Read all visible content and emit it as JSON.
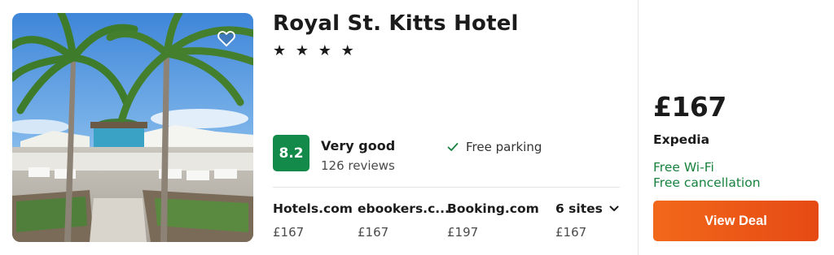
{
  "hotel": {
    "name": "Royal St. Kitts Hotel",
    "stars_text": "★ ★ ★ ★",
    "star_count": 4
  },
  "rating": {
    "score": "8.2",
    "label": "Very good",
    "reviews": "126 reviews",
    "badge_color": "#138a4a"
  },
  "amenity": {
    "label": "Free parking",
    "icon": "check-icon"
  },
  "sites": [
    {
      "name": "Hotels.com",
      "price": "£167"
    },
    {
      "name": "ebookers.c...",
      "price": "£167"
    },
    {
      "name": "Booking.com",
      "price": "£197"
    },
    {
      "name": "6 sites",
      "price": "£167"
    }
  ],
  "deal": {
    "price": "£167",
    "provider": "Expedia",
    "perks": [
      "Free Wi-Fi",
      "Free cancellation"
    ],
    "button_label": "View Deal",
    "button_color": "#f2681a",
    "perk_color": "#17823e"
  },
  "photo": {
    "favorite_icon": "heart-icon"
  }
}
